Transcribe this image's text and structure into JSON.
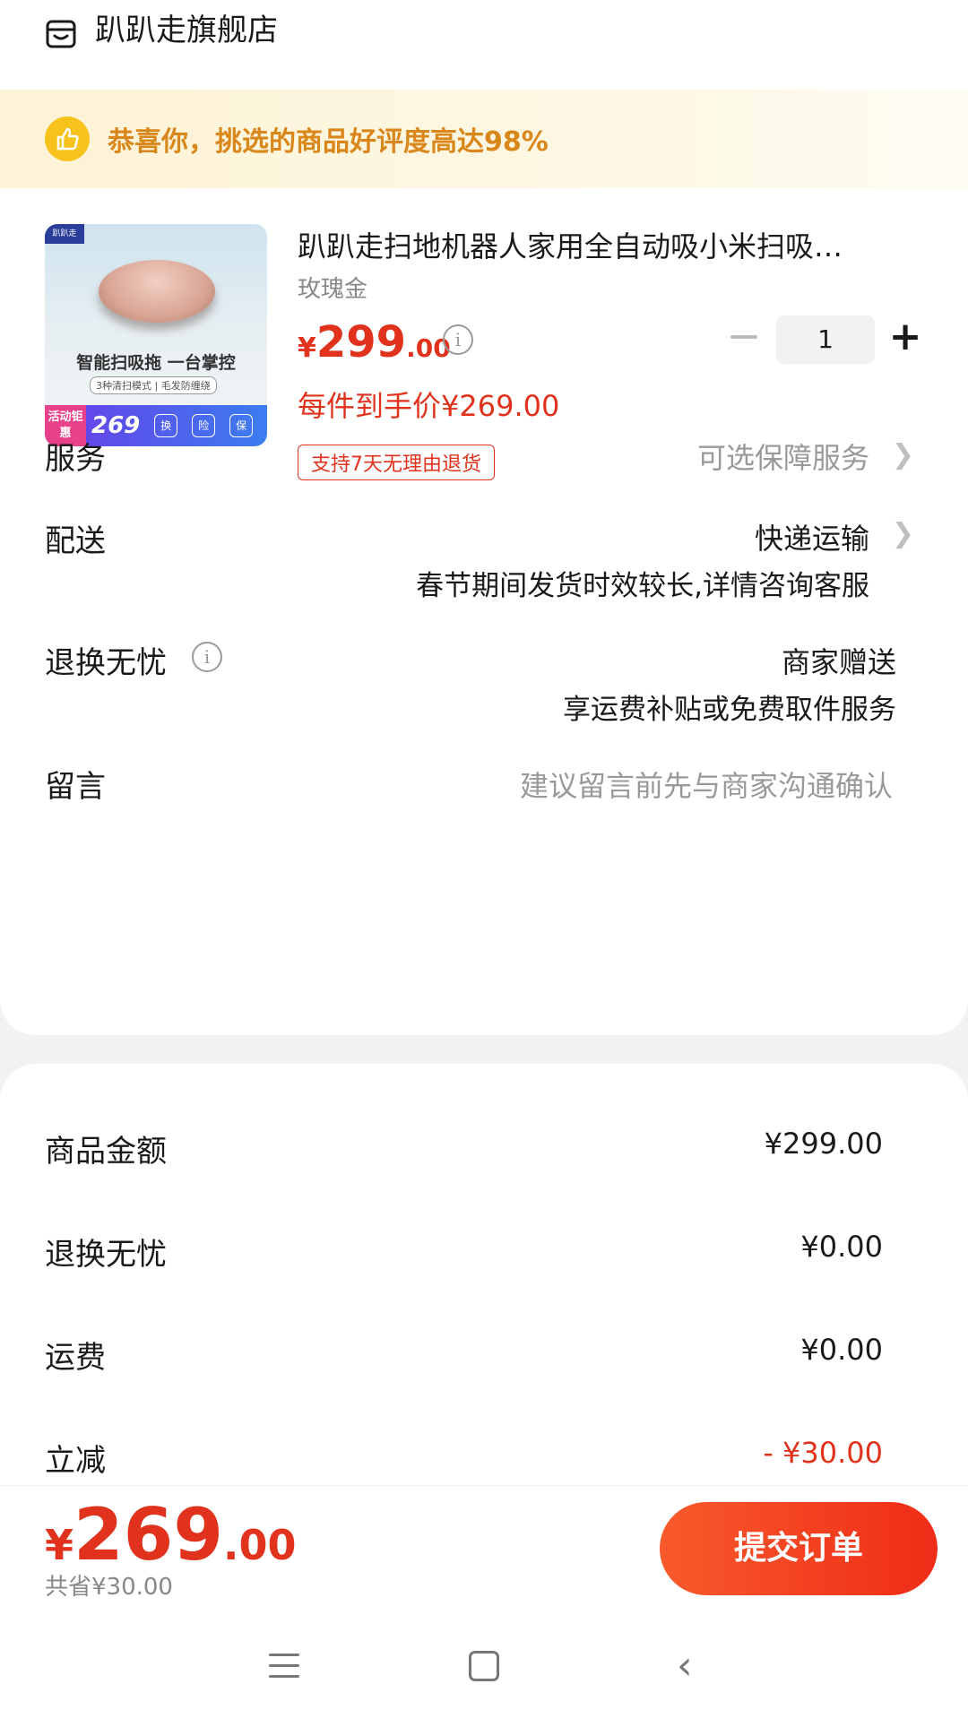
{
  "store": {
    "name": "趴趴走旗舰店",
    "icon": "store-icon"
  },
  "banner": {
    "text": "恭喜你，挑选的商品好评度高达98%",
    "icon": "thumbs-up-icon"
  },
  "product": {
    "image_texts": {
      "brand": "趴趴走",
      "headline": "智能扫吸拖 一台掌控",
      "sub": "3种清扫模式 | 毛发防缠绕",
      "activity": "活动钜惠",
      "promo_price": "269",
      "chip1": "换",
      "chip2": "险",
      "chip3": "保"
    },
    "title": "趴趴走扫地机器人家用全自动吸小米扫吸…",
    "variant": "玫瑰金",
    "price_symbol": "¥",
    "price_int": "299",
    "price_dec": ".00",
    "quantity": "1",
    "unit_price_label": "每件到手价¥269.00",
    "return_tag": "支持7天无理由退货"
  },
  "options": {
    "service": {
      "label": "服务",
      "value": "可选保障服务"
    },
    "delivery": {
      "label": "配送",
      "value": "快递运输",
      "note": "春节期间发货时效较长,详情咨询客服"
    },
    "worry_free": {
      "label": "退换无忧",
      "value": "商家赠送",
      "note": "享运费补贴或免费取件服务"
    },
    "message": {
      "label": "留言",
      "placeholder": "建议留言前先与商家沟通确认"
    }
  },
  "summary": [
    {
      "label": "商品金额",
      "value": "¥299.00"
    },
    {
      "label": "退换无忧",
      "value": "¥0.00"
    },
    {
      "label": "运费",
      "value": "¥0.00"
    },
    {
      "label": "立减",
      "value": "- ¥30.00"
    }
  ],
  "footer": {
    "total_symbol": "¥",
    "total_int": "269",
    "total_dec": ".00",
    "saved": "共省¥30.00",
    "submit_label": "提交订单"
  },
  "colors": {
    "accent": "#e0321c",
    "banner_text": "#d9861a",
    "button_start": "#f85a2c",
    "button_end": "#ef2c17"
  }
}
